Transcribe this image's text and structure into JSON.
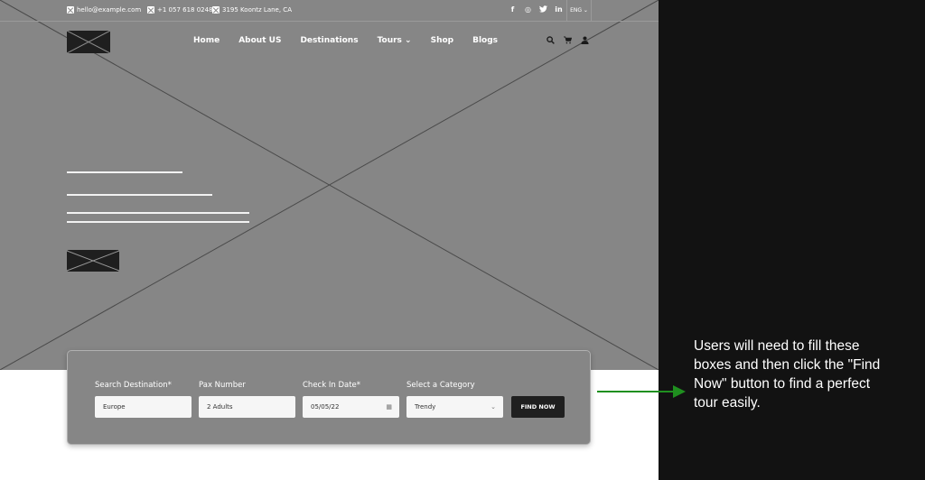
{
  "topbar": {
    "contacts": [
      {
        "icon": "image-placeholder-icon",
        "text": "hello@example.com"
      },
      {
        "icon": "image-placeholder-icon",
        "text": "+1 057 618 0248"
      },
      {
        "icon": "image-placeholder-icon",
        "text": "3195 Koontz Lane, CA"
      }
    ],
    "socials": [
      {
        "icon": "facebook-icon",
        "glyph": "f"
      },
      {
        "icon": "instagram-icon",
        "glyph": "◎"
      },
      {
        "icon": "twitter-icon",
        "glyph": "🐦"
      },
      {
        "icon": "linkedin-icon",
        "glyph": "in"
      }
    ],
    "language": "ENG ⌄"
  },
  "nav": {
    "items": [
      "Home",
      "About US",
      "Destinations",
      "Tours ⌄",
      "Shop",
      "Blogs"
    ],
    "icons": {
      "search": "⚲",
      "cart": "🛒",
      "user": "👤"
    }
  },
  "search_panel": {
    "fields": [
      {
        "label": "Search Destination*",
        "value": "Europe",
        "trail": ""
      },
      {
        "label": "Pax Number",
        "value": "2 Adults",
        "trail": ""
      },
      {
        "label": "Check In Date*",
        "value": "05/05/22",
        "trail": "▦"
      },
      {
        "label": "Select a Category",
        "value": "Trendy",
        "trail": "⌄"
      }
    ],
    "button": "FIND NOW"
  },
  "annotation": {
    "text": "Users will need to fill these boxes and then click the \"Find Now\" button to find a perfect tour easily.",
    "arrow_color": "#1f8f1f"
  }
}
